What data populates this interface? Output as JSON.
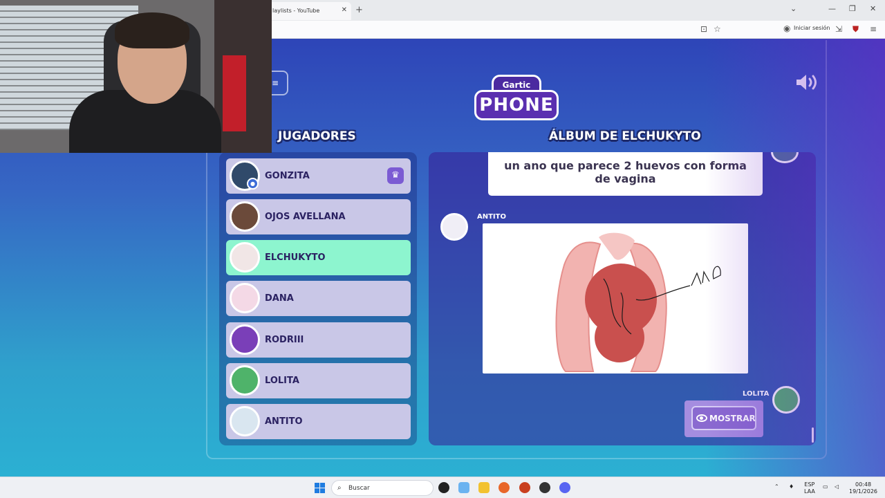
{
  "browser": {
    "tab_title": "laylists - YouTube",
    "tab_close": "✕",
    "new_tab": "+",
    "signin_label": "Iniciar sesión",
    "window_controls": [
      "⌄",
      "—",
      "❐",
      "✕"
    ]
  },
  "game": {
    "logo_top": "Gartic",
    "logo_bottom": "PHONE",
    "back_icon": "≡",
    "players_heading": "JUGADORES",
    "album_heading": "ÁLBUM DE ELCHUKYTO",
    "players": [
      {
        "name": "GONZITA",
        "owner": true,
        "active": false
      },
      {
        "name": "OJOS AVELLANA",
        "owner": false,
        "active": false
      },
      {
        "name": "ELCHUKYTO",
        "owner": false,
        "active": true
      },
      {
        "name": "DANA",
        "owner": false,
        "active": false
      },
      {
        "name": "RODRIII",
        "owner": false,
        "active": false
      },
      {
        "name": "LOLITA",
        "owner": false,
        "active": false
      },
      {
        "name": "ANTITO",
        "owner": false,
        "active": false
      }
    ],
    "album": {
      "text_entry": "un ano que parece 2 huevos con forma de vagina",
      "drawing_author": "ANTITO",
      "drawing_text": "ANO",
      "next_author": "LOLITA",
      "show_button": "MOSTRAR"
    }
  },
  "taskbar": {
    "search_placeholder": "Buscar",
    "lang_line1": "ESP",
    "lang_line2": "LAA",
    "time": "00:48",
    "date": "19/1/2026"
  },
  "colors": {
    "active_player": "#8df5cf",
    "player_row": "#c9c7e7",
    "accent_purple": "#7b5bd3"
  }
}
